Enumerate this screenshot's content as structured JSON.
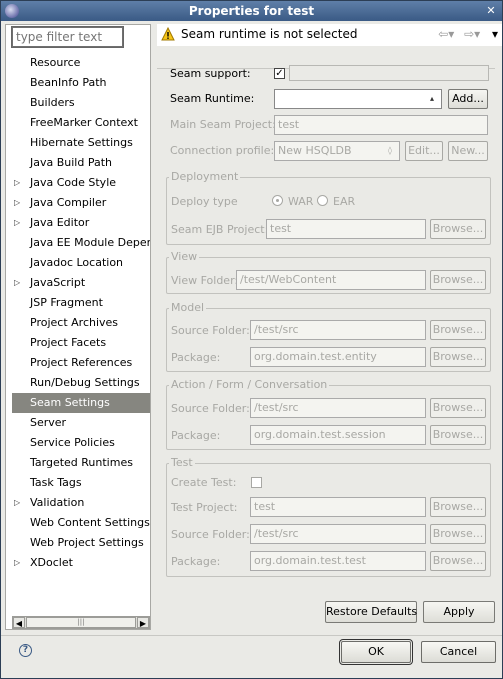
{
  "window": {
    "title": "Properties for test"
  },
  "filter": {
    "placeholder": "type filter text"
  },
  "tree": {
    "items": [
      {
        "label": "Resource",
        "expandable": false
      },
      {
        "label": "BeanInfo Path",
        "expandable": false
      },
      {
        "label": "Builders",
        "expandable": false
      },
      {
        "label": "FreeMarker Context",
        "expandable": false
      },
      {
        "label": "Hibernate Settings",
        "expandable": false
      },
      {
        "label": "Java Build Path",
        "expandable": false
      },
      {
        "label": "Java Code Style",
        "expandable": true
      },
      {
        "label": "Java Compiler",
        "expandable": true
      },
      {
        "label": "Java Editor",
        "expandable": true
      },
      {
        "label": "Java EE Module Depend",
        "expandable": false
      },
      {
        "label": "Javadoc Location",
        "expandable": false
      },
      {
        "label": "JavaScript",
        "expandable": true
      },
      {
        "label": "JSP Fragment",
        "expandable": false
      },
      {
        "label": "Project Archives",
        "expandable": false
      },
      {
        "label": "Project Facets",
        "expandable": false
      },
      {
        "label": "Project References",
        "expandable": false
      },
      {
        "label": "Run/Debug Settings",
        "expandable": false
      },
      {
        "label": "Seam Settings",
        "expandable": false,
        "selected": true
      },
      {
        "label": "Server",
        "expandable": false
      },
      {
        "label": "Service Policies",
        "expandable": false
      },
      {
        "label": "Targeted Runtimes",
        "expandable": false
      },
      {
        "label": "Task Tags",
        "expandable": false
      },
      {
        "label": "Validation",
        "expandable": true
      },
      {
        "label": "Web Content Settings",
        "expandable": false
      },
      {
        "label": "Web Project Settings",
        "expandable": false
      },
      {
        "label": "XDoclet",
        "expandable": true
      }
    ]
  },
  "message": {
    "text": "Seam runtime is not selected"
  },
  "form": {
    "seam_support_label": "Seam support:",
    "seam_support_checked": true,
    "seam_runtime_label": "Seam Runtime:",
    "seam_runtime_value": "",
    "add_label": "Add...",
    "main_project_label": "Main Seam Project:",
    "main_project_value": "test",
    "connection_label": "Connection profile:",
    "connection_value": "New HSQLDB",
    "edit_label": "Edit...",
    "new_label": "New..."
  },
  "deployment": {
    "title": "Deployment",
    "type_label": "Deploy type",
    "war_label": "WAR",
    "ear_label": "EAR",
    "war_selected": true,
    "ejb_label": "Seam EJB Project:",
    "ejb_value": "test",
    "browse_label": "Browse..."
  },
  "view": {
    "title": "View",
    "folder_label": "View Folder:",
    "folder_value": "/test/WebContent",
    "browse_label": "Browse..."
  },
  "model": {
    "title": "Model",
    "source_label": "Source Folder:",
    "source_value": "/test/src",
    "package_label": "Package:",
    "package_value": "org.domain.test.entity",
    "browse_label": "Browse..."
  },
  "action": {
    "title": "Action / Form / Conversation",
    "source_label": "Source Folder:",
    "source_value": "/test/src",
    "package_label": "Package:",
    "package_value": "org.domain.test.session",
    "browse_label": "Browse..."
  },
  "test": {
    "title": "Test",
    "create_label": "Create Test:",
    "create_checked": false,
    "project_label": "Test Project:",
    "project_value": "test",
    "source_label": "Source Folder:",
    "source_value": "/test/src",
    "package_label": "Package:",
    "package_value": "org.domain.test.test",
    "browse_label": "Browse..."
  },
  "buttons": {
    "restore_defaults": "Restore Defaults",
    "apply": "Apply",
    "ok": "OK",
    "cancel": "Cancel"
  },
  "colors": {
    "title_bar": "#3a5a85",
    "selection": "#868680",
    "warning": "#e8b000"
  }
}
